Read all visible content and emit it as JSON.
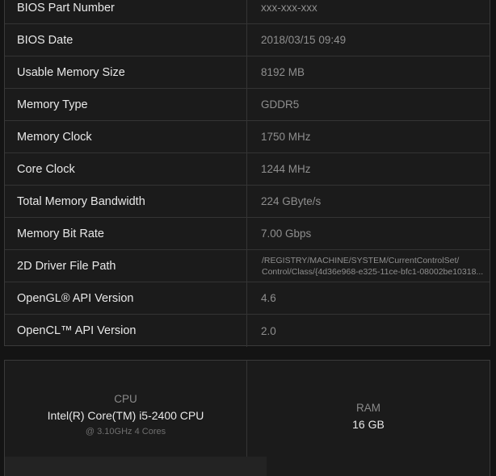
{
  "specs": [
    {
      "label": "BIOS Part Number",
      "value": "xxx-xxx-xxx"
    },
    {
      "label": "BIOS Date",
      "value": "2018/03/15 09:49"
    },
    {
      "label": "Usable Memory Size",
      "value": "8192 MB"
    },
    {
      "label": "Memory Type",
      "value": "GDDR5"
    },
    {
      "label": "Memory Clock",
      "value": "1750 MHz"
    },
    {
      "label": "Core Clock",
      "value": "1244 MHz"
    },
    {
      "label": "Total Memory Bandwidth",
      "value": "224 GByte/s"
    },
    {
      "label": "Memory Bit Rate",
      "value": "7.00 Gbps"
    },
    {
      "label": "2D Driver File Path",
      "value_line1": "/REGISTRY/MACHINE/SYSTEM/CurrentControlSet/",
      "value_line2": "Control/Class/{4d36e968-e325-11ce-bfc1-08002be10318..."
    },
    {
      "label": "OpenGL® API Version",
      "value": "4.6"
    },
    {
      "label": "OpenCL™ API Version",
      "value": "2.0"
    }
  ],
  "hardware": {
    "cpu": {
      "title": "CPU",
      "name": "Intel(R) Core(TM) i5-2400 CPU",
      "detail": "@ 3.10GHz 4 Cores"
    },
    "ram": {
      "title": "RAM",
      "name": "16 GB"
    }
  }
}
